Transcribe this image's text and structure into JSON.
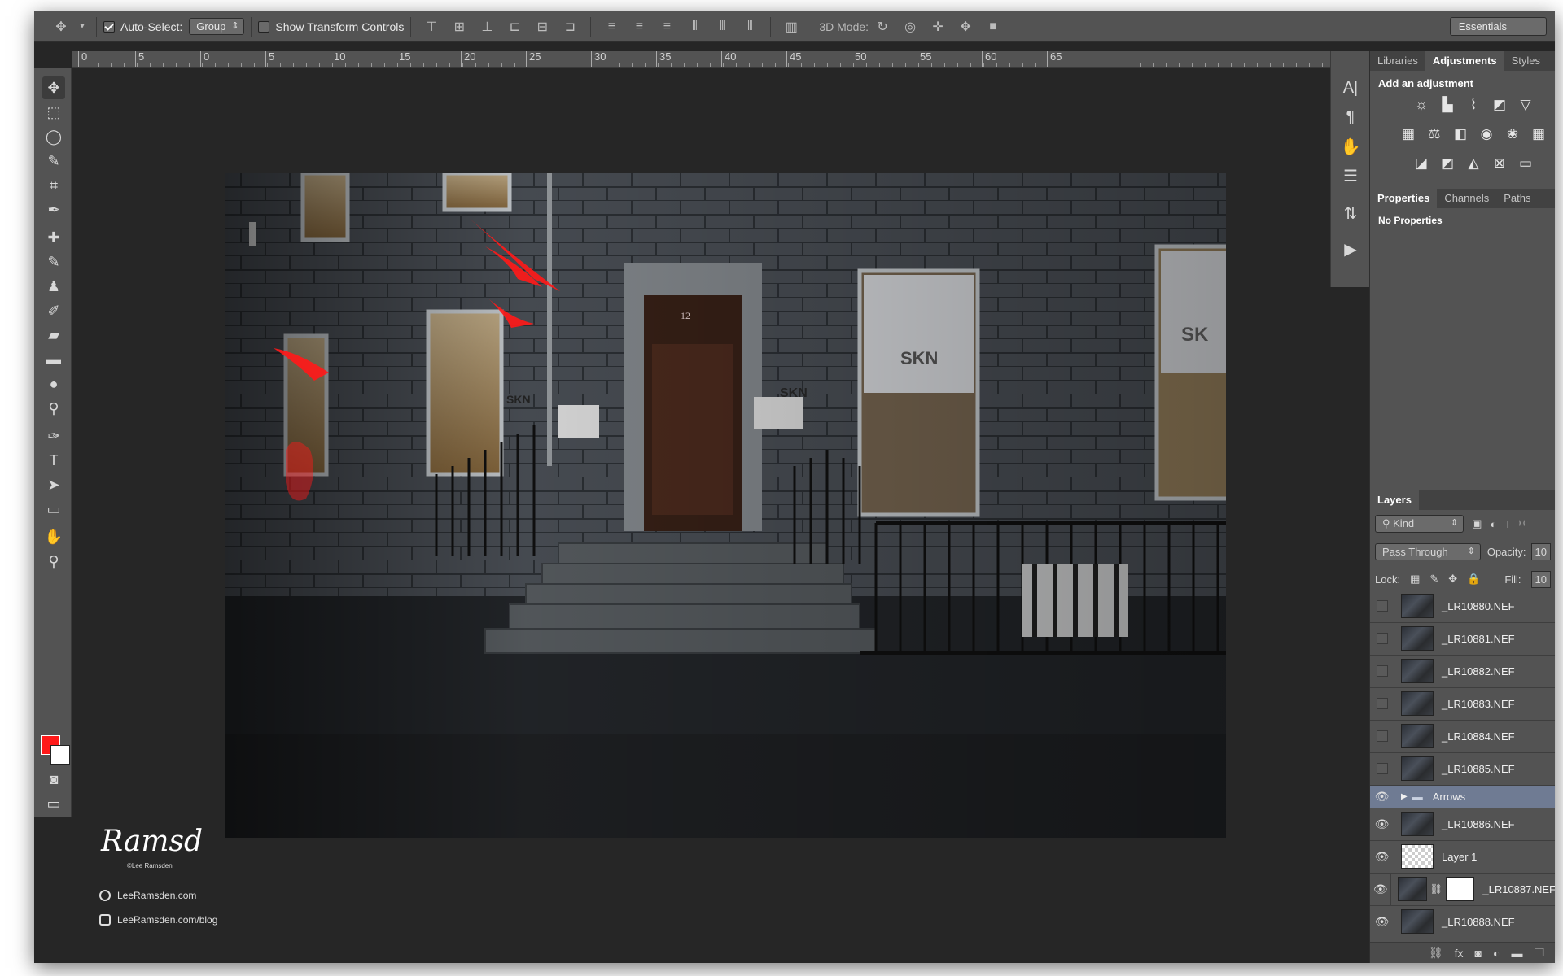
{
  "options_bar": {
    "auto_select_label": "Auto-Select:",
    "auto_select_value": "Group",
    "show_transform_label": "Show Transform Controls",
    "mode_3d_label": "3D Mode:",
    "workspace": "Essentials"
  },
  "ruler": [
    "0",
    "5",
    "0",
    "5",
    "10",
    "15",
    "20",
    "25",
    "30",
    "35",
    "40",
    "45",
    "50",
    "55",
    "60",
    "65"
  ],
  "top_panel": {
    "tabs": [
      "Libraries",
      "Adjustments",
      "Styles"
    ],
    "active_tab": "Adjustments",
    "title": "Add an adjustment"
  },
  "properties_panel": {
    "tabs": [
      "Properties",
      "Channels",
      "Paths"
    ],
    "active_tab": "Properties",
    "content": "No Properties"
  },
  "layers_panel": {
    "title": "Layers",
    "filter_value": "Kind",
    "blend_mode": "Pass Through",
    "opacity_label": "Opacity:",
    "opacity_value": "10",
    "lock_label": "Lock:",
    "fill_label": "Fill:",
    "fill_value": "10",
    "layers": [
      {
        "name": "_LR10880.NEF",
        "visible": false
      },
      {
        "name": "_LR10881.NEF",
        "visible": false
      },
      {
        "name": "_LR10882.NEF",
        "visible": false
      },
      {
        "name": "_LR10883.NEF",
        "visible": false
      },
      {
        "name": "_LR10884.NEF",
        "visible": false
      },
      {
        "name": "_LR10885.NEF",
        "visible": false
      },
      {
        "name": "Arrows",
        "visible": true,
        "group": true,
        "selected": true
      },
      {
        "name": "_LR10886.NEF",
        "visible": true
      },
      {
        "name": "Layer 1",
        "visible": true,
        "blank": true
      },
      {
        "name": "_LR10887.NEF",
        "visible": true,
        "mask": true
      },
      {
        "name": "_LR10888.NEF",
        "visible": true
      }
    ]
  },
  "canvas": {
    "signs": [
      "SKN",
      "SKN",
      "SKN",
      "SK"
    ],
    "door_number": "12"
  },
  "watermark": {
    "signature": "Ramsd",
    "small": "©Lee Ramsden",
    "site": "LeeRamsden.com",
    "blog": "LeeRamsden.com/blog"
  },
  "colors": {
    "foreground": "#ff1a1a",
    "background": "#ffffff",
    "accent_arrows": "#ff1a1a"
  }
}
